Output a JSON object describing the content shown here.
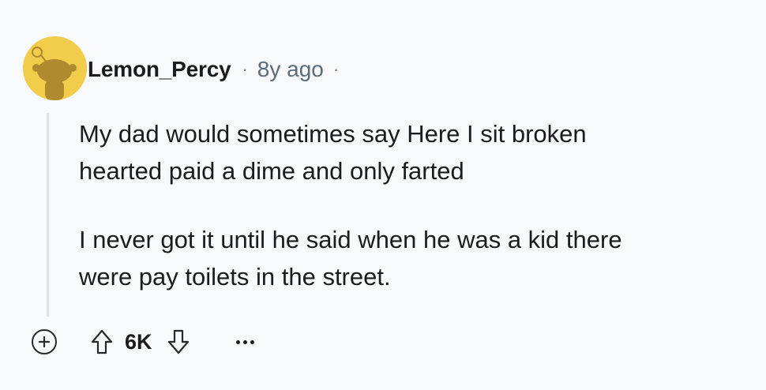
{
  "comment": {
    "author": "Lemon_Percy",
    "separator": "·",
    "timestamp": "8y ago",
    "paragraphs": [
      "My dad would sometimes say Here I sit broken\nhearted paid a dime and only farted",
      "I never got it until he said when he was a kid there\nwere pay toilets in the street."
    ],
    "avatar_icon": "snoo-avatar-icon",
    "colors": {
      "avatar_background": "#f2cd4c",
      "avatar_figure": "#b08a2c",
      "thread_line": "#dfe3e6",
      "meta_text": "#5c6c78"
    }
  },
  "actions": {
    "expand_icon": "plus-circle-icon",
    "upvote_icon": "arrow-up-icon",
    "vote_count": "6K",
    "downvote_icon": "arrow-down-icon",
    "more_icon": "more-horizontal-icon"
  }
}
